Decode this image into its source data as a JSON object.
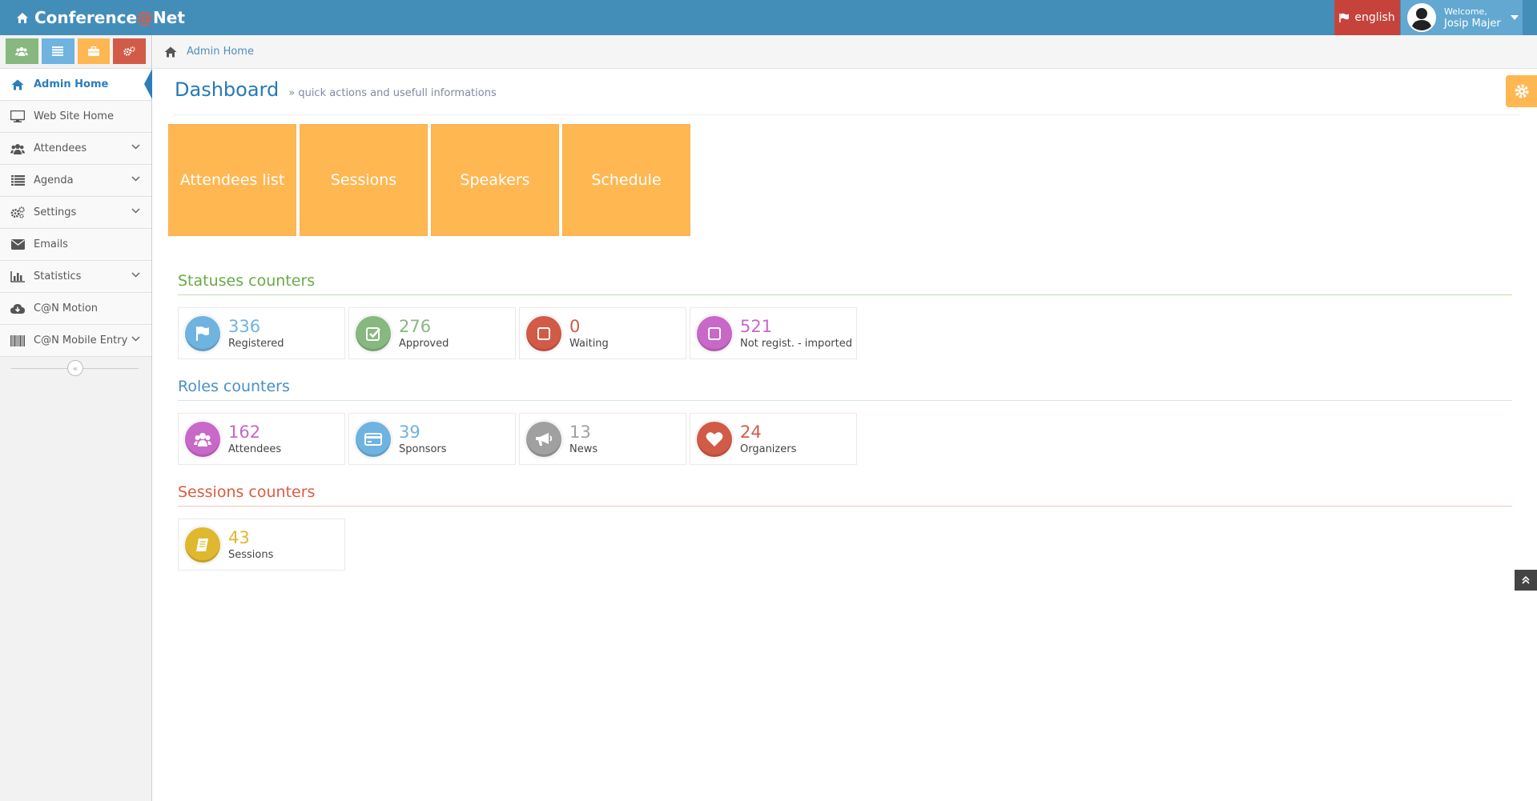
{
  "navbar": {
    "brand_part1": "Conference",
    "brand_at": "@",
    "brand_part2": "Net",
    "language": "english",
    "welcome": "Welcome,",
    "user_name": "Josip Majer"
  },
  "colors": {
    "navbar": "#438eb9",
    "language_bg": "#c6433b",
    "user_bg": "#62a8d1",
    "tile": "#ffb752",
    "green": "#87b87f",
    "blue": "#6fb3e0",
    "orange": "#ffb752",
    "red": "#d15b47",
    "pink": "#c868c8",
    "grey": "#a0a0a0",
    "yellow": "#e0b830"
  },
  "sidebar": {
    "shortcuts": [
      {
        "icon": "users-icon",
        "color": "#87b87f"
      },
      {
        "icon": "list-icon",
        "color": "#6fb3e0"
      },
      {
        "icon": "briefcase-icon",
        "color": "#ffb752"
      },
      {
        "icon": "gears-icon",
        "color": "#d15b47"
      }
    ],
    "items": [
      {
        "label": "Admin Home",
        "icon": "home-icon",
        "active": true
      },
      {
        "label": "Web Site Home",
        "icon": "desktop-icon"
      },
      {
        "label": "Attendees",
        "icon": "users-icon",
        "has_submenu": true
      },
      {
        "label": "Agenda",
        "icon": "list-icon",
        "has_submenu": true
      },
      {
        "label": "Settings",
        "icon": "gears-icon",
        "has_submenu": true
      },
      {
        "label": "Emails",
        "icon": "envelope-icon"
      },
      {
        "label": "Statistics",
        "icon": "bar-chart-icon",
        "has_submenu": true
      },
      {
        "label": "C@N Motion",
        "icon": "cloud-download-icon"
      },
      {
        "label": "C@N Mobile Entry",
        "icon": "barcode-icon",
        "has_submenu": true
      }
    ],
    "collapse_glyph": "«"
  },
  "breadcrumb": {
    "home_label": "Admin Home"
  },
  "page_header": {
    "title": "Dashboard",
    "subtitle_glyph": "»",
    "subtitle": "quick actions and usefull informations"
  },
  "tiles": [
    "Attendees list",
    "Sessions",
    "Speakers",
    "Schedule"
  ],
  "statuses": {
    "title": "Statuses counters",
    "items": [
      {
        "value": "336",
        "label": "Registered",
        "icon": "flag-icon",
        "color": "#6fb3e0"
      },
      {
        "value": "276",
        "label": "Approved",
        "icon": "check-square-icon",
        "color": "#87b87f"
      },
      {
        "value": "0",
        "label": "Waiting",
        "icon": "square-icon",
        "color": "#d15b47"
      },
      {
        "value": "521",
        "label": "Not regist. - imported",
        "icon": "square-icon",
        "color": "#c868c8"
      }
    ]
  },
  "roles": {
    "title": "Roles counters",
    "items": [
      {
        "value": "162",
        "label": "Attendees",
        "icon": "users-icon",
        "color": "#c868c8"
      },
      {
        "value": "39",
        "label": "Sponsors",
        "icon": "credit-card-icon",
        "color": "#6fb3e0"
      },
      {
        "value": "13",
        "label": "News",
        "icon": "bullhorn-icon",
        "color": "#a0a0a0"
      },
      {
        "value": "24",
        "label": "Organizers",
        "icon": "heart-icon",
        "color": "#d15b47"
      }
    ]
  },
  "sessions": {
    "title": "Sessions counters",
    "items": [
      {
        "value": "43",
        "label": "Sessions",
        "icon": "book-icon",
        "color": "#e0b830"
      }
    ]
  }
}
